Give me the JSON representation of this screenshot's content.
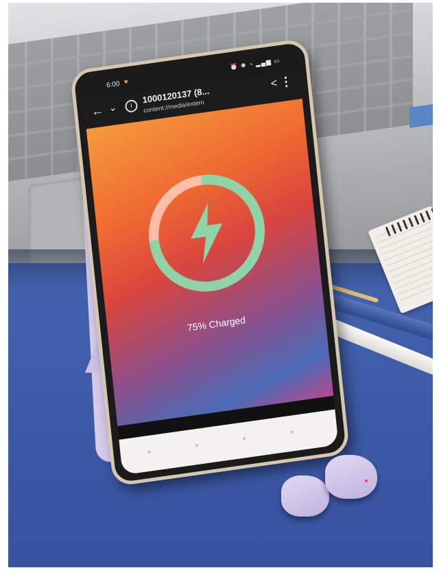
{
  "status_bar": {
    "time": "6:00",
    "icons": "⏰ ✱ ◔ ▂▄▆ ▭"
  },
  "toolbar": {
    "title": "1000120137 (8...",
    "subtitle": "content://media/extern"
  },
  "content": {
    "charge_label": "75% Charged",
    "charge_percent": 75
  },
  "colors": {
    "ring_fill": "#8fd3a6",
    "heart": "#f2a14b"
  },
  "icons": {
    "back": "back-arrow-icon",
    "collapse": "chevron-down-icon",
    "info": "info-icon",
    "share": "share-icon",
    "more": "more-vertical-icon",
    "bolt": "lightning-bolt-icon"
  }
}
